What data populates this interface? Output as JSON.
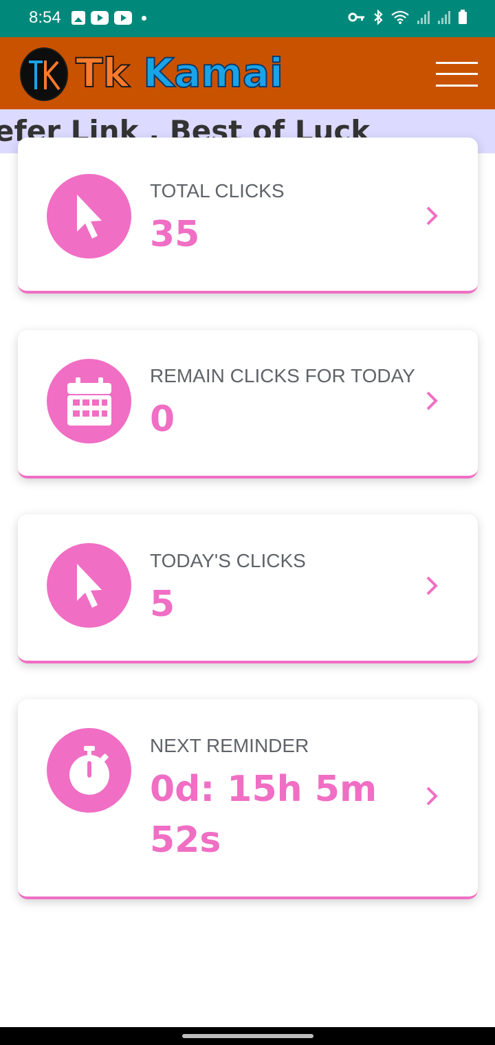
{
  "status_bar": {
    "time": "8:54",
    "left_icons": [
      "gallery-icon",
      "youtube-icon",
      "youtube-icon",
      "dot-icon"
    ],
    "right_icons": [
      "key-icon",
      "bluetooth-icon",
      "wifi-icon",
      "signal-icon",
      "signal-icon",
      "battery-icon"
    ],
    "color": "#00897b"
  },
  "header": {
    "logo_tk": "Tk",
    "logo_kamai": "Kamai",
    "color": "#c95200"
  },
  "marquee": {
    "text": "efer Link . Best of Luck",
    "background": "#dcdaff"
  },
  "cards": [
    {
      "label": "TOTAL CLICKS",
      "value": "35",
      "icon": "cursor-icon"
    },
    {
      "label": "REMAIN CLICKS FOR TODAY",
      "value": "0",
      "icon": "calendar-icon"
    },
    {
      "label": "TODAY'S CLICKS",
      "value": "5",
      "icon": "cursor-icon"
    },
    {
      "label": "NEXT REMINDER",
      "value_line1": "0d: 15h 5m",
      "value_line2": "52s",
      "icon": "stopwatch-icon"
    }
  ],
  "accent": "#f06ec4"
}
